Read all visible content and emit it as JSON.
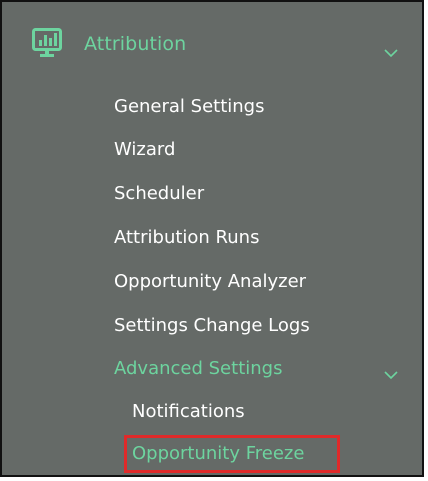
{
  "section": {
    "title": "Attribution",
    "icon": "bar-chart-monitor-icon",
    "expand_icon": "chevron-down-icon"
  },
  "nav": {
    "general_settings": "General Settings",
    "wizard": "Wizard",
    "scheduler": "Scheduler",
    "attribution_runs": "Attribution Runs",
    "opportunity_analyzer": "Opportunity Analyzer",
    "settings_change_logs": "Settings Change Logs",
    "advanced_settings": "Advanced Settings"
  },
  "advanced": {
    "expand_icon": "chevron-down-icon",
    "notifications": "Notifications",
    "opportunity_freeze": "Opportunity Freeze"
  },
  "colors": {
    "panel_bg": "#656a67",
    "accent": "#6dd49f",
    "highlight": "#e02a2a",
    "text": "#ffffff"
  }
}
